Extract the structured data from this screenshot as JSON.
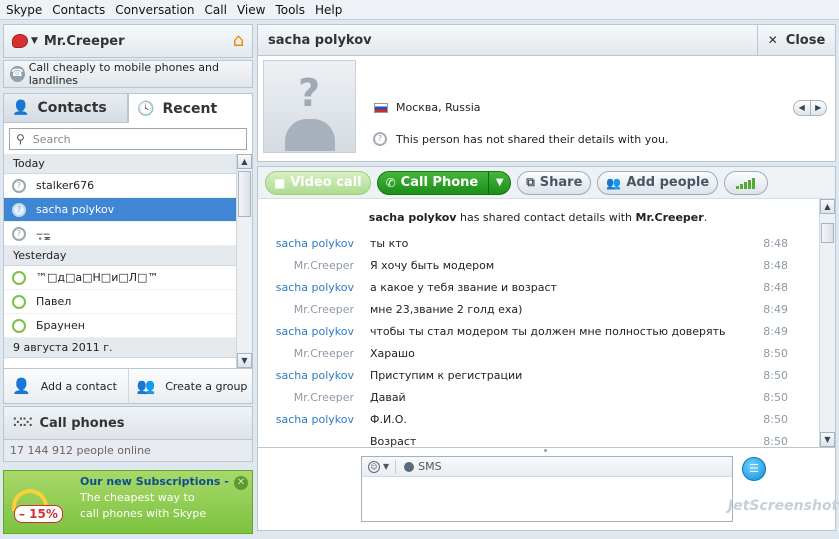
{
  "menu": [
    "Skype",
    "Contacts",
    "Conversation",
    "Call",
    "View",
    "Tools",
    "Help"
  ],
  "profile": {
    "name": "Mr.Creeper"
  },
  "promo_bar": {
    "text": "Call cheaply to mobile phones and landlines"
  },
  "tabs": {
    "contacts": "Contacts",
    "recent": "Recent"
  },
  "search": {
    "placeholder": "Search"
  },
  "recent": {
    "today": "Today",
    "today_items": [
      "stalker676",
      "sacha polykov",
      "‒̥‒̥̳"
    ],
    "yesterday": "Yesterday",
    "yesterday_items": [
      "™□д□а□Н□и□Л□™",
      "Павел",
      "Браунен"
    ],
    "date_group": "9 августа 2011 г."
  },
  "actions": {
    "add_contact": "Add a contact",
    "create_group": "Create a group"
  },
  "call_phones": "Call phones",
  "online": "17 144 912 people online",
  "ad": {
    "title": "Our new Subscriptions -",
    "text": "The cheapest way to call phones with Skype",
    "badge": "– 15%"
  },
  "conversation": {
    "title": "sacha polykov",
    "close": "Close",
    "location": "Москва, Russia",
    "details": "This person has not shared their details with you.",
    "buttons": {
      "video": "Video call",
      "call": "Call Phone",
      "share": "Share",
      "add_people": "Add people"
    },
    "system": {
      "who": "sacha polykov",
      "mid": " has shared contact details with ",
      "to": "Mr.Creeper",
      "end": "."
    },
    "messages": [
      {
        "who": "sacha polykov",
        "text": "ты кто",
        "time": "8:48"
      },
      {
        "who": "Mr.Creeper",
        "text": "Я хочу быть модером",
        "time": "8:48"
      },
      {
        "who": "sacha polykov",
        "text": "а какое у тебя звание и возраст",
        "time": "8:48"
      },
      {
        "who": "Mr.Creeper",
        "text": "мне 23,звание 2 голд еха)",
        "time": "8:49"
      },
      {
        "who": "sacha polykov",
        "text": "чтобы ты стал модером ты должен мне полностью доверять",
        "time": "8:49"
      },
      {
        "who": "Mr.Creeper",
        "text": "Харашо",
        "time": "8:50"
      },
      {
        "who": "sacha polykov",
        "text": "Приступим к регистрации",
        "time": "8:50"
      },
      {
        "who": "Mr.Creeper",
        "text": "Давай",
        "time": "8:50"
      },
      {
        "who": "sacha polykov",
        "text": "Ф.И.О.",
        "time": "8:50"
      },
      {
        "who": "",
        "text": "Возраст",
        "time": "8:50"
      }
    ],
    "compose": {
      "sms": "SMS"
    }
  },
  "watermark": "JetScreenshot",
  "colors": {
    "accent": "#3f86d4",
    "call_green": "#1c8f1a",
    "sender_blue": "#2d7bc6"
  }
}
